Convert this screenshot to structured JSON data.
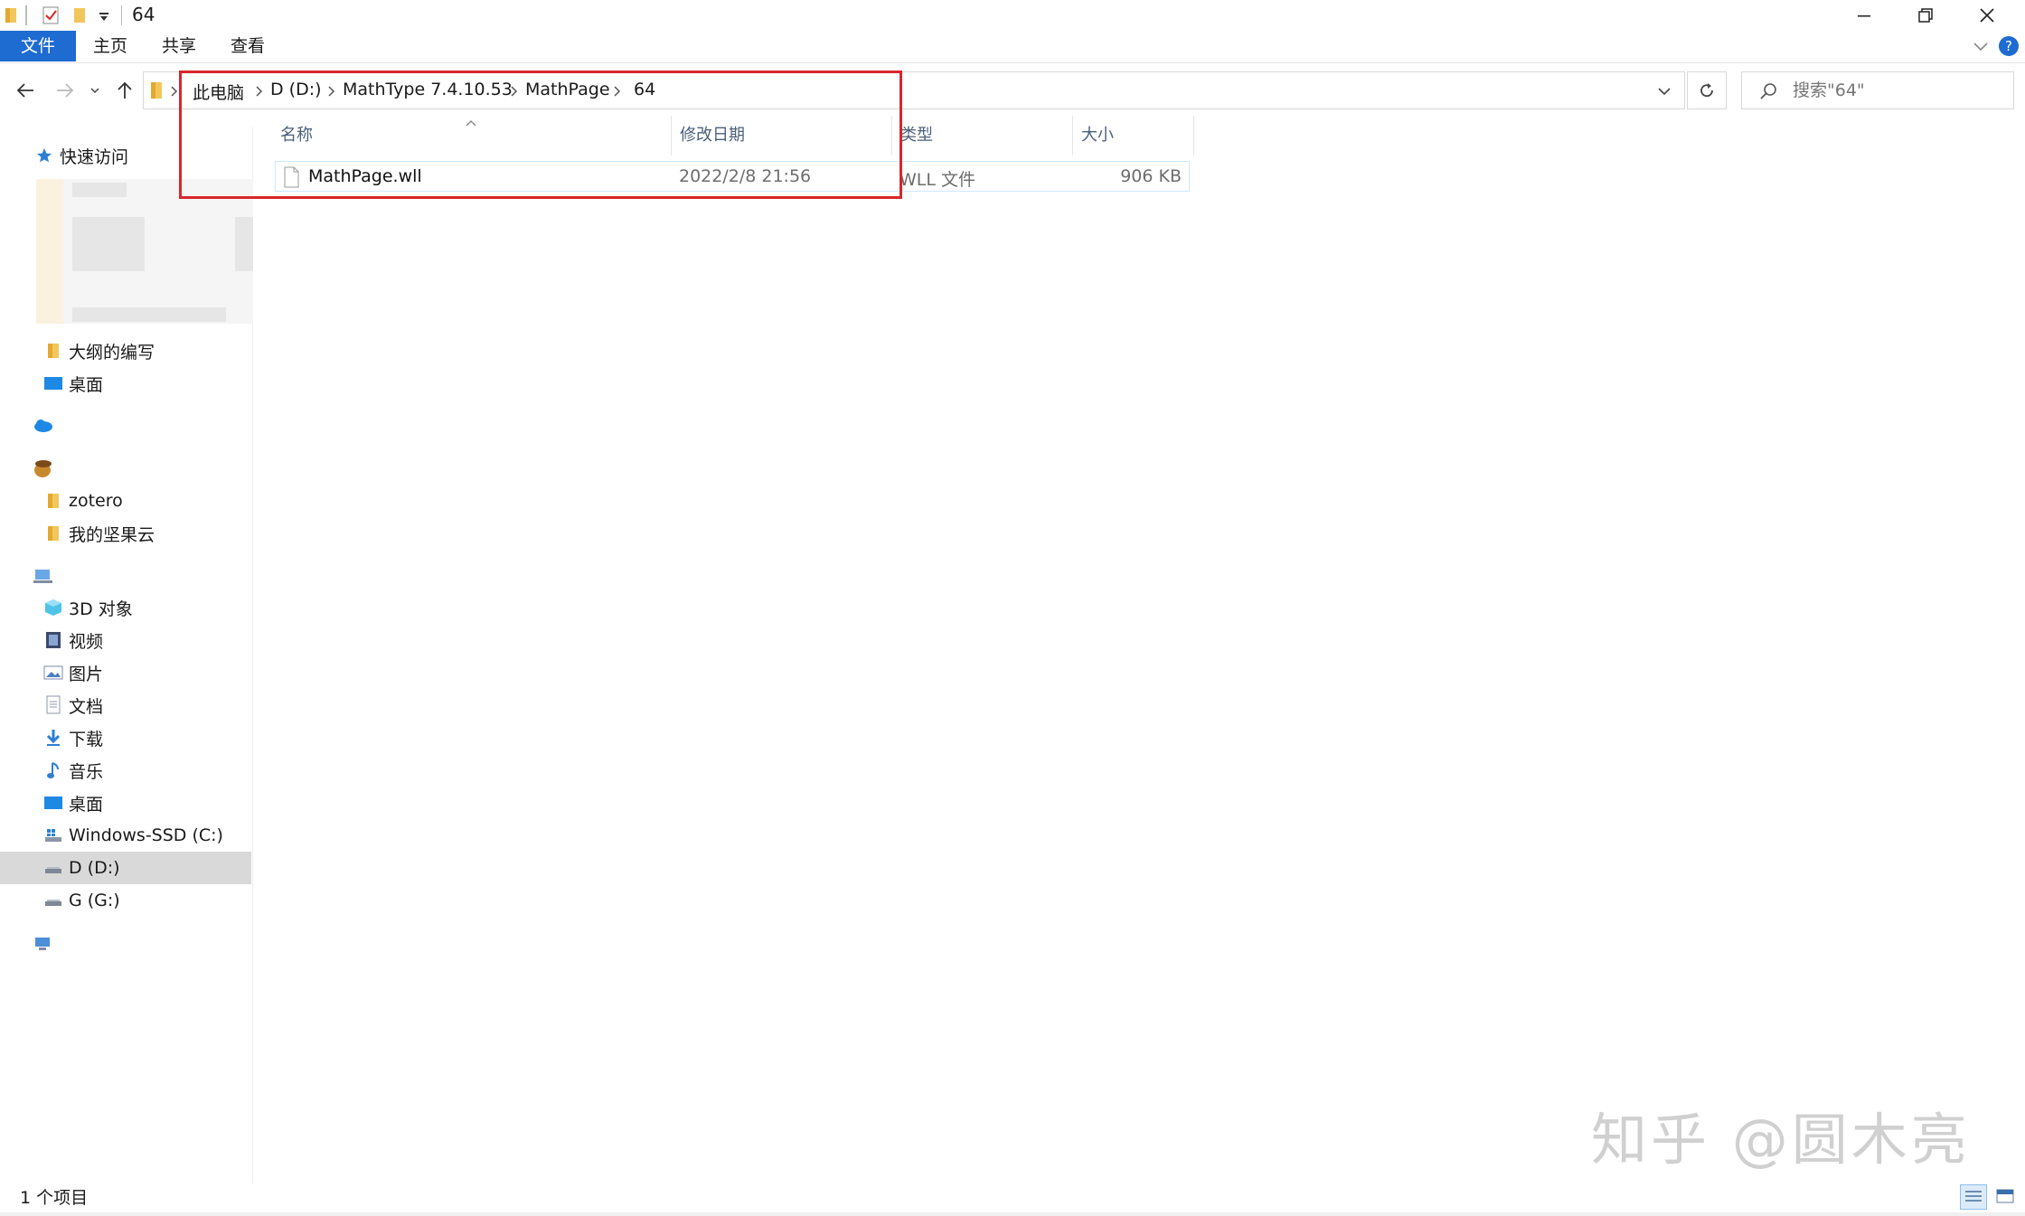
{
  "window": {
    "title": "64"
  },
  "ribbon": {
    "tabs": [
      "文件",
      "主页",
      "共享",
      "查看"
    ]
  },
  "address": {
    "crumbs": [
      "此电脑",
      "D (D:)",
      "MathType 7.4.10.53",
      "MathPage",
      "64"
    ]
  },
  "search": {
    "placeholder": "搜索\"64\""
  },
  "sidebar": {
    "quick_access": "快速访问",
    "items": [
      "大纲的编写",
      "桌面",
      "zotero",
      "我的坚果云",
      "3D 对象",
      "视频",
      "图片",
      "文档",
      "下载",
      "音乐",
      "桌面",
      "Windows-SSD (C:)",
      "D (D:)",
      "G (G:)"
    ]
  },
  "filelist": {
    "headers": {
      "name": "名称",
      "date": "修改日期",
      "type": "类型",
      "size": "大小"
    },
    "rows": [
      {
        "name": "MathPage.wll",
        "date": "2022/2/8 21:56",
        "type": "WLL 文件",
        "size": "906 KB"
      }
    ]
  },
  "status": {
    "items": "1 个项目"
  },
  "watermark": "知乎 @圆木亮",
  "colors": {
    "accent": "#1e6bd1",
    "highlight": "#d9262b",
    "selected": "#d9d9d9"
  }
}
